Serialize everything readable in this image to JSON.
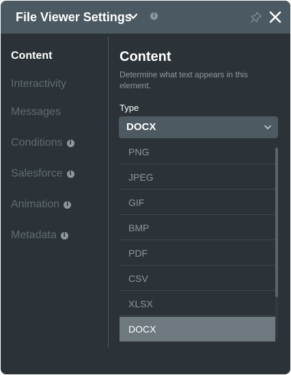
{
  "header": {
    "title": "File Viewer Settings",
    "title_icon": "chevron-down-icon",
    "info_icon": "info-icon",
    "pin_icon": "pin-icon",
    "close_icon": "close-icon"
  },
  "sidebar": {
    "items": [
      {
        "label": "Content",
        "active": true,
        "info": false
      },
      {
        "label": "Interactivity",
        "active": false,
        "info": false
      },
      {
        "label": "Messages",
        "active": false,
        "info": false
      },
      {
        "label": "Conditions",
        "active": false,
        "info": true
      },
      {
        "label": "Salesforce",
        "active": false,
        "info": true
      },
      {
        "label": "Animation",
        "active": false,
        "info": true
      },
      {
        "label": "Metadata",
        "active": false,
        "info": true
      }
    ]
  },
  "main": {
    "section_title": "Content",
    "section_description": "Determine what text appears in this element.",
    "type_field": {
      "label": "Type",
      "value": "DOCX",
      "options": [
        "PNG",
        "JPEG",
        "GIF",
        "BMP",
        "PDF",
        "CSV",
        "XLSX",
        "DOCX"
      ],
      "selected": "DOCX"
    }
  },
  "colors": {
    "panel_bg": "#2b3338",
    "header_bg": "#4b5a62",
    "select_bg": "#4d5a61",
    "selected_option_bg": "#6e7a80",
    "inactive_text": "#5f6c72",
    "active_text": "#ffffff"
  }
}
